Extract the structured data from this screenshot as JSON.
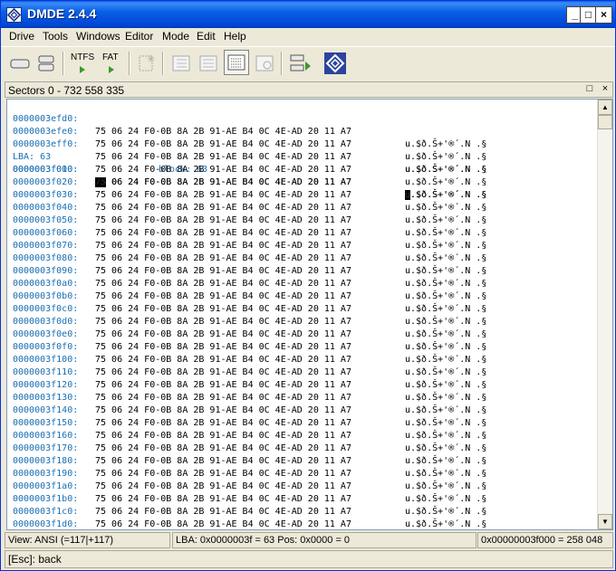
{
  "window": {
    "title": "DMDE 2.4.4",
    "min_label": "_",
    "max_label": "□",
    "close_label": "×"
  },
  "menu": [
    {
      "label": "Drive"
    },
    {
      "label": "Tools"
    },
    {
      "label": "Windows"
    },
    {
      "label": "Editor"
    },
    {
      "label": "Mode"
    },
    {
      "label": "Edit"
    },
    {
      "label": "Help"
    }
  ],
  "toolbar": {
    "ntfs_label": "NTFS",
    "fat_label": "FAT",
    "icons": [
      "drive-open-icon",
      "partitions-icon",
      "ntfs-icon",
      "fat-icon",
      "star-icon",
      "table-icon",
      "list-icon",
      "hex-icon",
      "find-icon",
      "copy-icon",
      "dmde-logo-icon"
    ]
  },
  "panel": {
    "header": "Sectors 0 - 732 558 335",
    "restore_label": "□",
    "close_label": "×"
  },
  "hex_view": {
    "hex_bytes": "75 06 24 F0-0B 8A 2B 91-AE B4 0C 4E-AD 20 11 A7",
    "ascii": "u.$ð.Š+'®´.N­ .§",
    "selected_byte": "75",
    "selected_char": "u",
    "hex_rest": " 06 24 F0-0B 8A 2B 91-AE B4 0C 4E-AD 20 11 A7",
    "ascii_rest": ".$ð.Š+'®´.N­ .§",
    "pre_rows": [
      "0000003efd0:",
      "0000003efe0:",
      "0000003eff0:"
    ],
    "lba_label": "LBA: 63",
    "block_label": "block: 63",
    "selected_row": "0000003f000:",
    "post_rows": [
      "0000003f010:",
      "0000003f020:",
      "0000003f030:",
      "0000003f040:",
      "0000003f050:",
      "0000003f060:",
      "0000003f070:",
      "0000003f080:",
      "0000003f090:",
      "0000003f0a0:",
      "0000003f0b0:",
      "0000003f0c0:",
      "0000003f0d0:",
      "0000003f0e0:",
      "0000003f0f0:",
      "0000003f100:",
      "0000003f110:",
      "0000003f120:",
      "0000003f130:",
      "0000003f140:",
      "0000003f150:",
      "0000003f160:",
      "0000003f170:",
      "0000003f180:",
      "0000003f190:",
      "0000003f1a0:",
      "0000003f1b0:",
      "0000003f1c0:",
      "0000003f1d0:"
    ]
  },
  "status": {
    "view": "View: ANSI (=117|+117)",
    "position": "LBA: 0x0000003f = 63  Pos: 0x0000 = 0",
    "offset": "0x00000003f000 = 258 048"
  },
  "hint": "[Esc]: back",
  "colors": {
    "address": "#1a6fb3",
    "titlebar": "#0a5fe6"
  }
}
